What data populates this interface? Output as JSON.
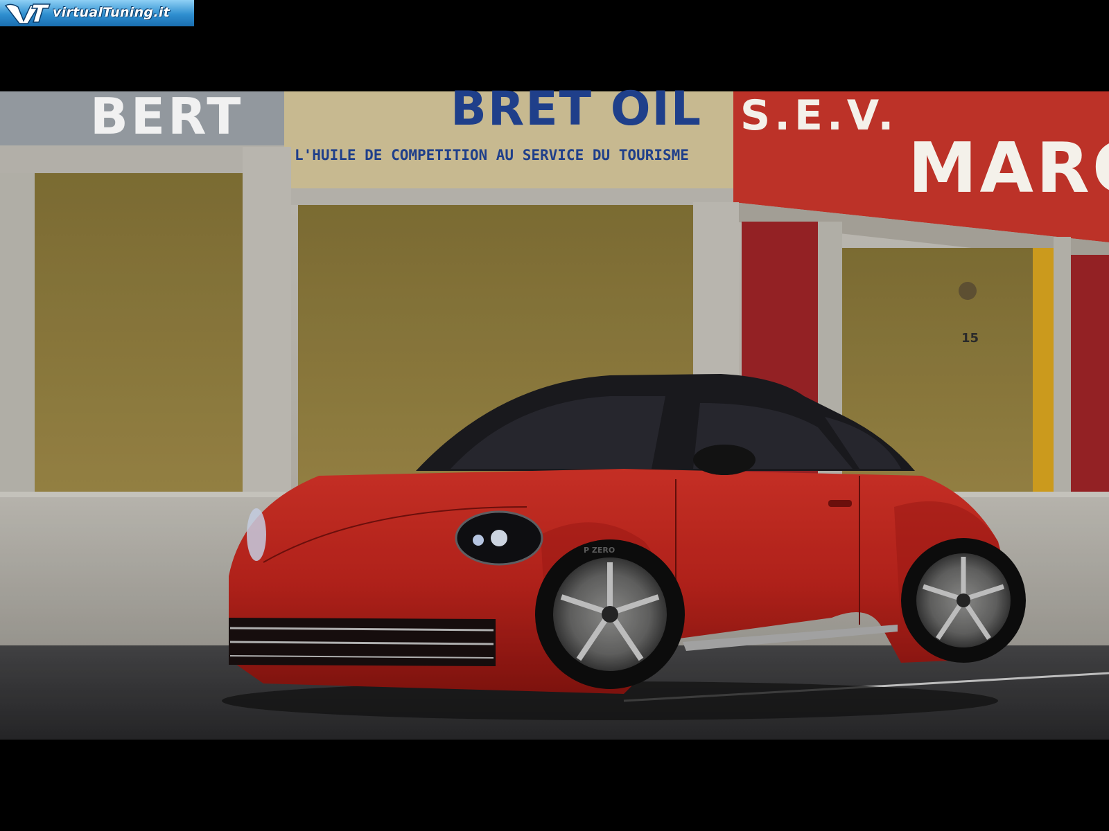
{
  "watermark": {
    "text": "virtualTuning.it",
    "icon": "vt-logo-icon"
  },
  "scene": {
    "sign_left_partial": "BERT",
    "sign_middle_top": "BRET OIL",
    "sign_middle_slogan": "L'HUILE DE COMPETITION AU SERVICE DU TOURISME",
    "sign_right_top": "S.E.V.",
    "sign_right_main": "MARC",
    "pit_number": "15",
    "car_color": "#c8261e",
    "tire_text": "P ZERO"
  }
}
